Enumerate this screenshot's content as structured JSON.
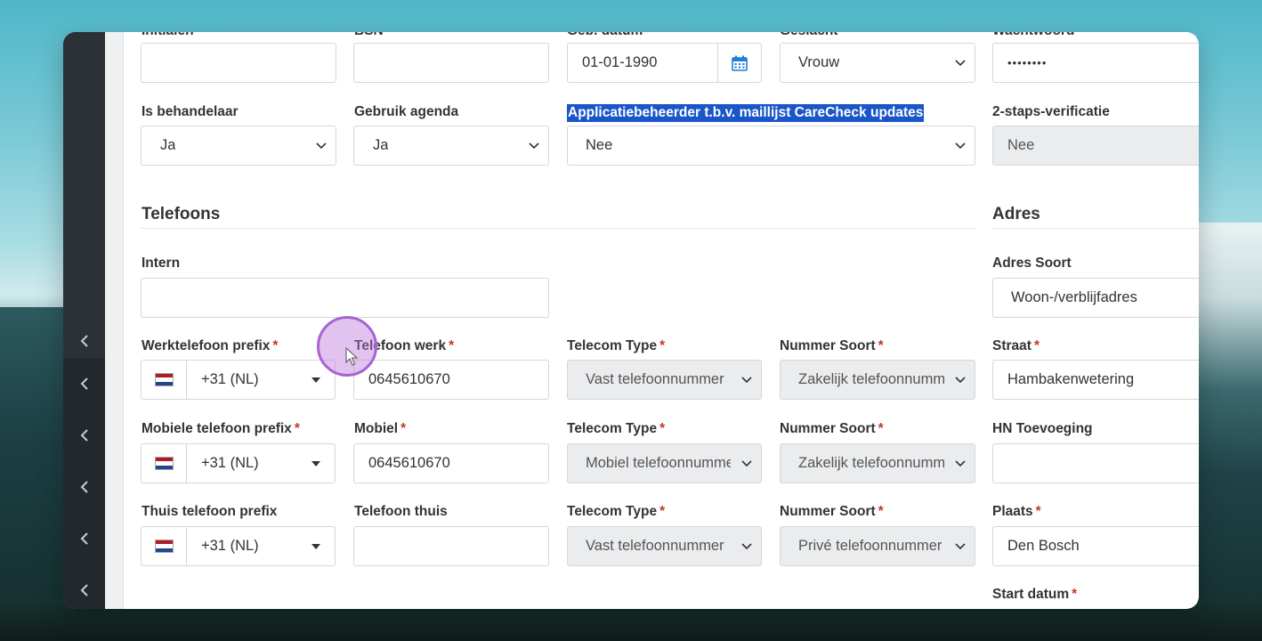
{
  "form": {
    "row0": {
      "initialen": {
        "label": "Initialen",
        "value": ""
      },
      "bsn": {
        "label": "BSN",
        "value": ""
      },
      "geb_datum": {
        "label": "Geb. datum",
        "value": "01-01-1990"
      },
      "geslacht": {
        "label": "Geslacht",
        "value": "Vrouw"
      },
      "wachtwoord": {
        "label": "Wachtwoord",
        "value": "••••••••"
      }
    },
    "row1": {
      "is_behandelaar": {
        "label": "Is behandelaar",
        "value": "Ja"
      },
      "gebruik_agenda": {
        "label": "Gebruik agenda",
        "value": "Ja"
      },
      "applicatiebeheerder": {
        "label": "Applicatiebeheerder t.b.v. maillijst CareCheck updates",
        "value": "Nee"
      },
      "twee_staps": {
        "label": "2-staps-verificatie",
        "value": "Nee"
      }
    }
  },
  "telefoons": {
    "title": "Telefoons",
    "intern": {
      "label": "Intern",
      "value": ""
    },
    "werk": {
      "prefix_label": "Werktelefoon prefix",
      "prefix_value": "+31 (NL)",
      "number_label": "Telefoon werk",
      "number_value": "0645610670",
      "telecom_label": "Telecom Type",
      "telecom_value": "Vast telefoonnummer",
      "soort_label": "Nummer Soort",
      "soort_value": "Zakelijk telefoonnummer"
    },
    "mobiel": {
      "prefix_label": "Mobiele telefoon prefix",
      "prefix_value": "+31 (NL)",
      "number_label": "Mobiel",
      "number_value": "0645610670",
      "telecom_label": "Telecom Type",
      "telecom_value": "Mobiel telefoonnummer",
      "soort_label": "Nummer Soort",
      "soort_value": "Zakelijk telefoonnummer"
    },
    "thuis": {
      "prefix_label": "Thuis telefoon prefix",
      "prefix_value": "+31 (NL)",
      "number_label": "Telefoon thuis",
      "number_value": "",
      "telecom_label": "Telecom Type",
      "telecom_value": "Vast telefoonnummer",
      "soort_label": "Nummer Soort",
      "soort_value": "Privé telefoonnummer"
    },
    "required_mark": "*"
  },
  "adres": {
    "title": "Adres",
    "soort": {
      "label": "Adres Soort",
      "value": "Woon-/verblijfadres"
    },
    "straat": {
      "label": "Straat",
      "value": "Hambakenwetering"
    },
    "hn_toevoeging": {
      "label": "HN Toevoeging",
      "value": ""
    },
    "plaats": {
      "label": "Plaats",
      "value": "Den Bosch"
    },
    "start_datum": {
      "label": "Start datum"
    }
  },
  "icons": {
    "sidebar_collapse": "chevron-left-icon",
    "calendar": "calendar-icon",
    "select_caret": "chevron-down-icon",
    "flag": "netherlands-flag-icon"
  },
  "colors": {
    "sidebar": "#2d3338",
    "highlight": "#1a56c9",
    "required": "#c0392b",
    "calendar": "#1f7fd4",
    "readonly_bg": "#ebecee"
  }
}
